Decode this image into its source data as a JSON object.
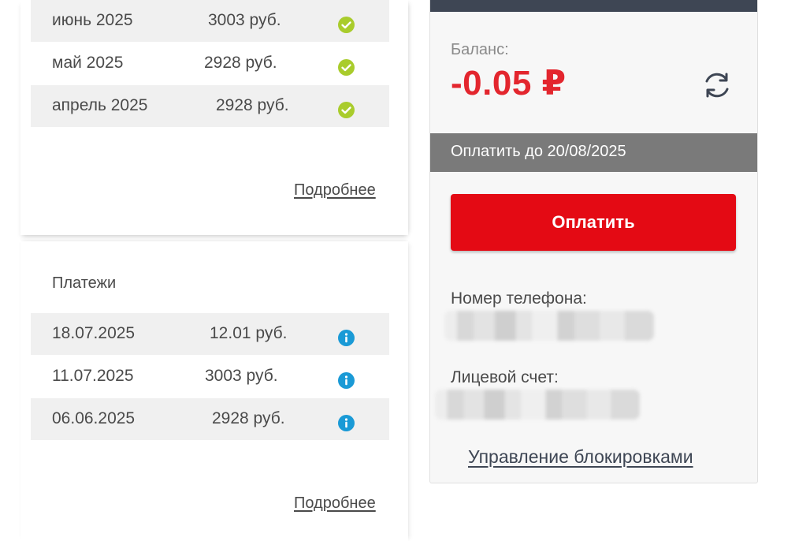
{
  "history": {
    "rows": [
      {
        "period": "июнь 2025",
        "amount": "3003 руб.",
        "status_icon": "check-circle-icon"
      },
      {
        "period": "май 2025",
        "amount": "2928 руб.",
        "status_icon": "check-circle-icon"
      },
      {
        "period": "апрель 2025",
        "amount": "2928 руб.",
        "status_icon": "check-circle-icon"
      }
    ],
    "more_label": "Подробнее"
  },
  "payments": {
    "title": "Платежи",
    "rows": [
      {
        "date": "18.07.2025",
        "amount": "12.01 руб.",
        "status_icon": "info-icon"
      },
      {
        "date": "11.07.2025",
        "amount": "3003 руб.",
        "status_icon": "info-icon"
      },
      {
        "date": "06.06.2025",
        "amount": "2928 руб.",
        "status_icon": "info-icon"
      }
    ],
    "more_label": "Подробнее"
  },
  "account": {
    "balance_label": "Баланс:",
    "balance_value": "-0.05 ₽",
    "refresh_icon": "refresh-icon",
    "due_text": "Оплатить до 20/08/2025",
    "pay_button": "Оплатить",
    "phone_label": "Номер телефона:",
    "account_label": "Лицевой счет:",
    "manage_link": "Управление блокировками"
  },
  "colors": {
    "accent_red": "#e40a14",
    "balance_red": "#e3262e",
    "check_green": "#a9cc2c",
    "info_blue": "#1a9ad6",
    "header_dark": "#3e4654",
    "due_gray": "#7a7a7a"
  }
}
